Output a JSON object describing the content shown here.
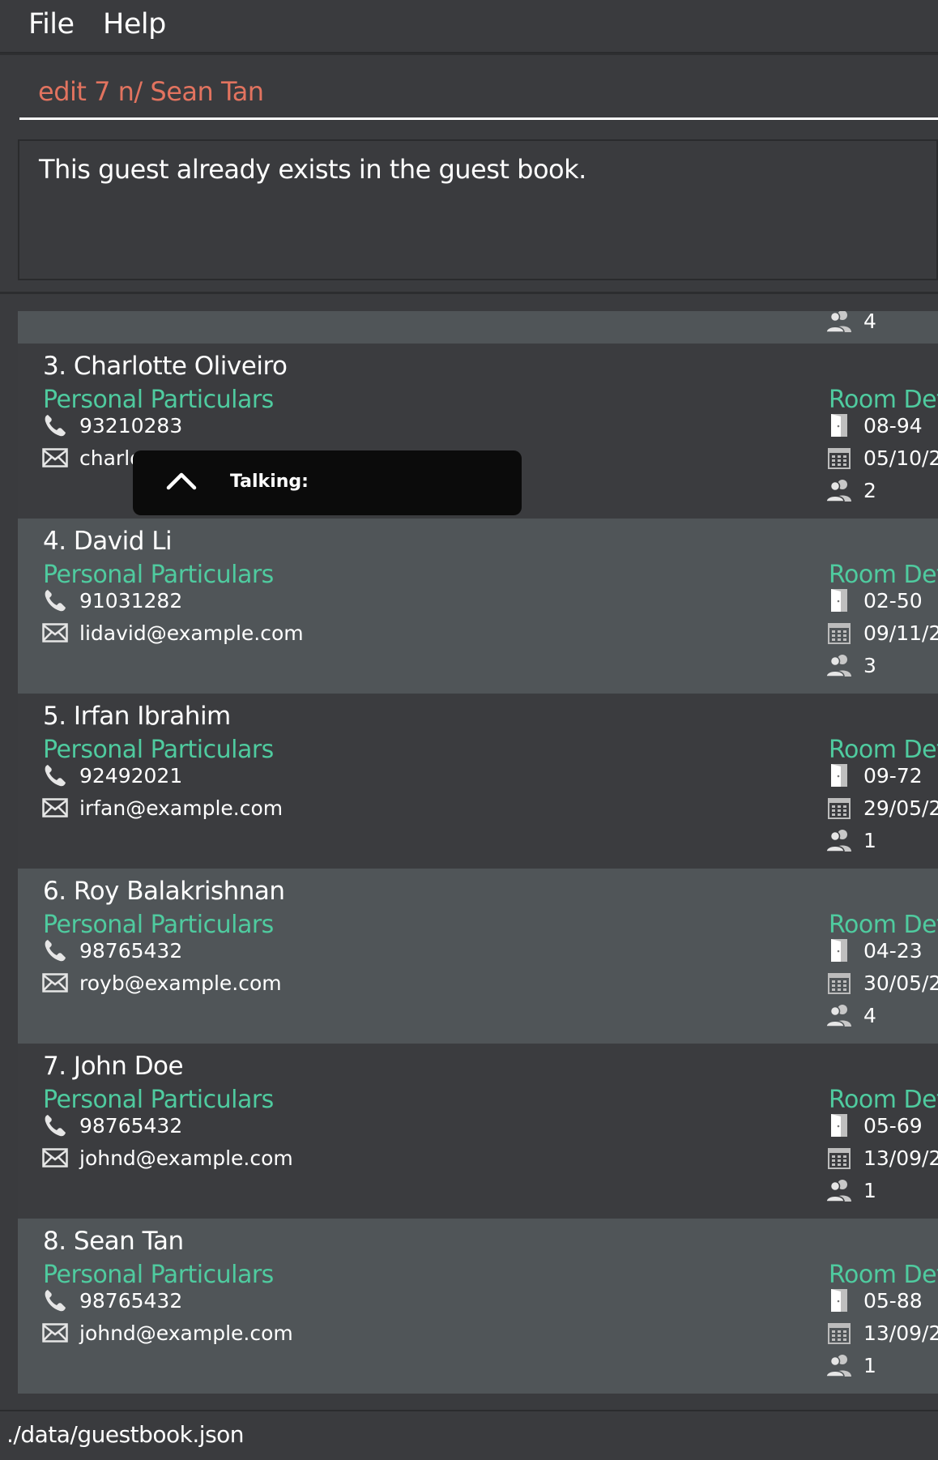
{
  "menu": {
    "file": "File",
    "help": "Help"
  },
  "command": {
    "value": "edit 7 n/ Sean Tan"
  },
  "result": {
    "message": "This guest already exists in the guest book."
  },
  "list": {
    "section_personal": "Personal Particulars",
    "section_room": "Room Det",
    "partial_card": {
      "guests": "4"
    },
    "cards": [
      {
        "title": "3.  Charlotte Oliveiro",
        "phone": "93210283",
        "email": "charlo",
        "room": "08-94",
        "date": "05/10/2",
        "guests": "2"
      },
      {
        "title": "4.  David Li",
        "phone": "91031282",
        "email": "lidavid@example.com",
        "room": "02-50",
        "date": "09/11/2",
        "guests": "3"
      },
      {
        "title": "5.  Irfan Ibrahim",
        "phone": "92492021",
        "email": "irfan@example.com",
        "room": "09-72",
        "date": "29/05/2",
        "guests": "1"
      },
      {
        "title": "6.  Roy Balakrishnan",
        "phone": "98765432",
        "email": "royb@example.com",
        "room": "04-23",
        "date": "30/05/2",
        "guests": "4"
      },
      {
        "title": "7.  John Doe",
        "phone": "98765432",
        "email": "johnd@example.com",
        "room": "05-69",
        "date": "13/09/2",
        "guests": "1"
      },
      {
        "title": "8.  Sean Tan",
        "phone": "98765432",
        "email": "johnd@example.com",
        "room": "05-88",
        "date": "13/09/2",
        "guests": "1"
      }
    ]
  },
  "popup": {
    "label": "Talking:"
  },
  "status": {
    "path": "./data/guestbook.json"
  },
  "icons": {
    "phone": "phone-icon",
    "email": "email-icon",
    "room": "door-icon",
    "date": "calendar-icon",
    "guests": "people-icon",
    "chevron": "chevron-up-icon"
  },
  "colors": {
    "background": "#3a3b3e",
    "card_alt": "#505558",
    "command_text": "#e2735f",
    "accent_green": "#4fcb9f"
  }
}
